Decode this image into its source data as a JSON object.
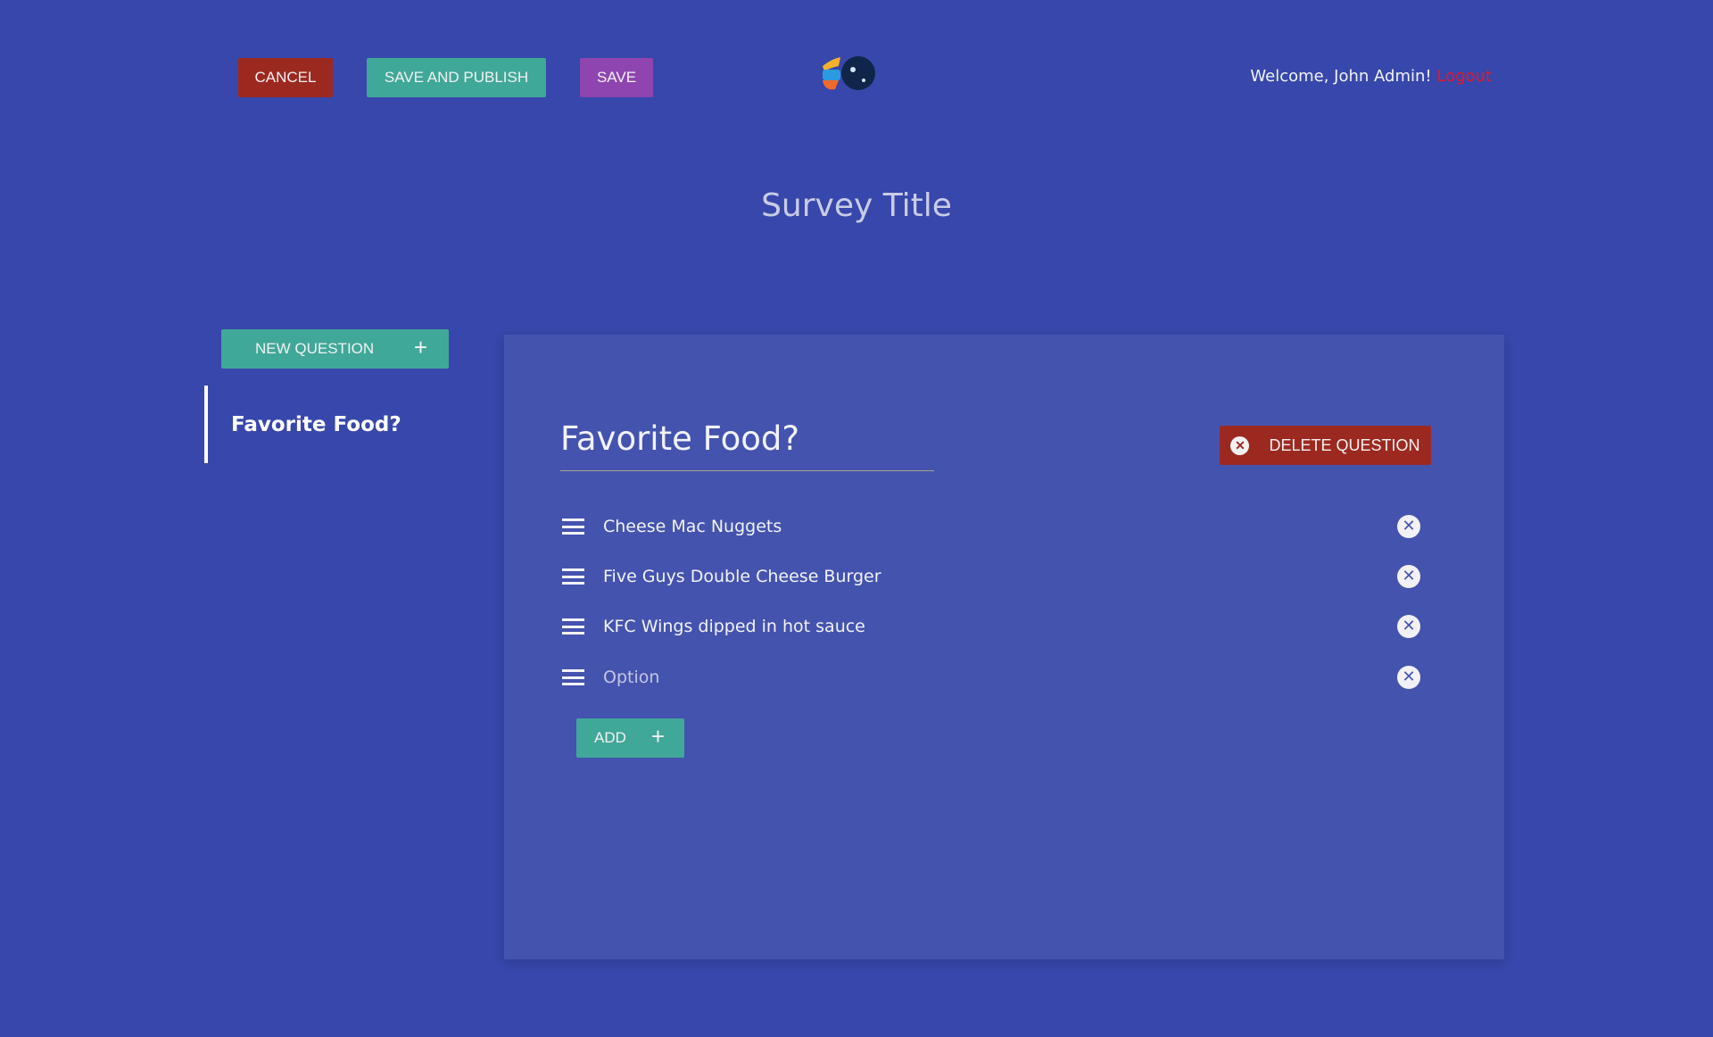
{
  "header": {
    "cancel_label": "CANCEL",
    "save_publish_label": "SAVE AND PUBLISH",
    "save_label": "SAVE",
    "welcome_text": "Welcome, John Admin!",
    "logout_label": "Logout"
  },
  "survey_title": "Survey Title",
  "sidebar": {
    "new_question_label": "NEW QUESTION",
    "new_question_icon": "plus-icon",
    "items": [
      {
        "label": "Favorite Food?"
      }
    ]
  },
  "question": {
    "title": "Favorite Food?",
    "delete_label": "DELETE QUESTION",
    "options": [
      {
        "value": "Cheese Mac Nuggets"
      },
      {
        "value": "Five Guys Double Cheese Burger"
      },
      {
        "value": "KFC Wings dipped in hot sauce"
      },
      {
        "value": "",
        "placeholder": "Option"
      }
    ],
    "add_label": "ADD"
  },
  "colors": {
    "background": "#3747ab",
    "panel": "#4453ae",
    "danger": "#9c2920",
    "primary": "#40a898",
    "save": "#8e45af",
    "logout": "#e0192a"
  }
}
